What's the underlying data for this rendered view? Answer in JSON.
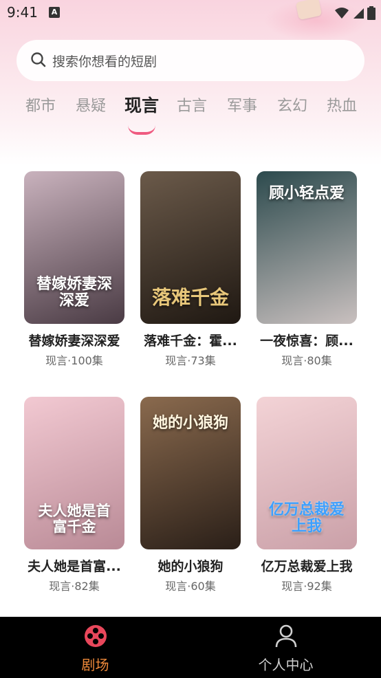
{
  "status_bar": {
    "time": "9:41",
    "notification_icon": "A"
  },
  "search": {
    "placeholder": "搜索你想看的短剧"
  },
  "tabs": [
    {
      "label": "都市",
      "active": false
    },
    {
      "label": "悬疑",
      "active": false
    },
    {
      "label": "现言",
      "active": true
    },
    {
      "label": "古言",
      "active": false
    },
    {
      "label": "军事",
      "active": false
    },
    {
      "label": "玄幻",
      "active": false
    },
    {
      "label": "热血",
      "active": false
    }
  ],
  "dramas": [
    {
      "title": "替嫁娇妻深深爱",
      "poster_text": "替嫁娇妻深深爱",
      "meta": "现言·100集",
      "colors": [
        "#c9b2bd",
        "#4a3b44"
      ]
    },
    {
      "title": "落难千金：霍...",
      "poster_text": "落难千金",
      "meta": "现言·73集",
      "colors": [
        "#6b5a4a",
        "#1f1812"
      ]
    },
    {
      "title": "一夜惊喜：顾...",
      "poster_text": "顾小轻点爱",
      "meta": "现言·80集",
      "colors": [
        "#2c4a4d",
        "#c9c0bf"
      ]
    },
    {
      "title": "夫人她是首富...",
      "poster_text": "夫人她是首富千金",
      "meta": "现言·82集",
      "colors": [
        "#f2c9d2",
        "#b98a96"
      ]
    },
    {
      "title": "她的小狼狗",
      "poster_text": "她的小狼狗",
      "meta": "现言·60集",
      "colors": [
        "#8a6a4e",
        "#2a1f18"
      ]
    },
    {
      "title": "亿万总裁爱上我",
      "poster_text": "亿万总裁爱上我",
      "meta": "现言·92集",
      "colors": [
        "#f3d3d6",
        "#caa0a8"
      ]
    }
  ],
  "bottom_nav": [
    {
      "label": "剧场",
      "icon": "film-reel-icon",
      "active": true,
      "color": "#f08a3a",
      "icon_color": "#e8475b"
    },
    {
      "label": "个人中心",
      "icon": "user-icon",
      "active": false,
      "color": "#d0d0d0",
      "icon_color": "#d0d0d0"
    }
  ]
}
